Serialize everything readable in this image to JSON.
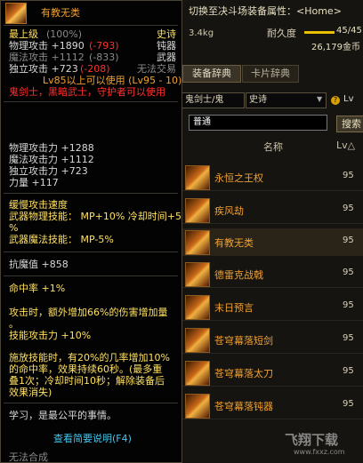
{
  "bg": {
    "switch_title": "切换至决斗场装备属性：<Home>",
    "weight": "3.4kg",
    "durability_label": "耐久度",
    "durability_value": "45/45",
    "durability_fraction": 1.0,
    "gold": "26,179金币",
    "tab_equip": "装备辞典",
    "tab_card": "卡片辞典",
    "job_select": "鬼剑士/鬼",
    "rarity_select": "史诗",
    "lv_label": "Lv",
    "search_value": "普通",
    "search_button": "搜索",
    "col_name": "名称",
    "col_lv": "Lv△",
    "items": [
      {
        "name": "永恒之王权",
        "lv": "95"
      },
      {
        "name": "疾风劫",
        "lv": "95"
      },
      {
        "name": "有教无类",
        "lv": "95"
      },
      {
        "name": "德雷克战戟",
        "lv": "95"
      },
      {
        "name": "末日预言",
        "lv": "95"
      },
      {
        "name": "苍穹幕落短剑",
        "lv": "95"
      },
      {
        "name": "苍穹幕落太刀",
        "lv": "95"
      },
      {
        "name": "苍穹幕落钝器",
        "lv": "95"
      }
    ],
    "watermark": "飞翔下载",
    "watermark_url": "www.fxxz.com"
  },
  "tooltip": {
    "name": "有教无类",
    "grade": "最上级",
    "grade_pct": "(100%)",
    "rarity": "史诗",
    "phys_atk_line": "物理攻击 +1890",
    "phys_atk_diff": "(-793)",
    "mag_atk_line": "魔法攻击 +1112",
    "mag_atk_diff": "(-833)",
    "ind_atk_line": "独立攻击 +723",
    "ind_atk_diff": "(-208)",
    "type1": "钝器",
    "type2": "武器",
    "trade": "无法交易",
    "req_level": "Lv85以上可以使用 (Lv95 - 10)",
    "req_class": "鬼剑士，黑暗武士，守护者可以使用",
    "stat_phys": "物理攻击力 +1288",
    "stat_mag": "魔法攻击力 +1112",
    "stat_ind": "独立攻击力 +723",
    "stat_str": "力量 +117",
    "slow_speed": "缓慢攻击速度",
    "skill_phys": "武器物理技能： MP+10% 冷却时间+5",
    "skill_phys_2": "%",
    "skill_mag": "武器魔法技能： MP-5%",
    "anti_demon": "抗魔值 +858",
    "hit_rate": "命中率 +1%",
    "extra_dmg_1": "攻击时，额外增加66%的伤害增加量",
    "extra_dmg_2": "。",
    "skill_atk": "技能攻击力 +10%",
    "cast_1": "施放技能时，有20%的几率增加10%",
    "cast_2": "的命中率，效果持续60秒。(最多重",
    "cast_3": "叠1次；冷却时间10秒；解除装备后",
    "cast_4": "效果消失)",
    "flavor": "学习，是最公平的事情。",
    "link": "查看简要说明(F4)",
    "fusion": "无法合成"
  }
}
